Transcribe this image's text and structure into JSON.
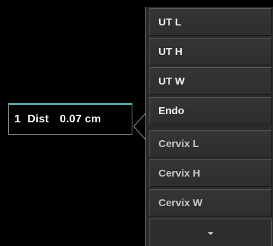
{
  "readout": {
    "index": "1",
    "label": "Dist",
    "value": "0.07 cm"
  },
  "menu": {
    "items": [
      {
        "label": "UT L"
      },
      {
        "label": "UT H"
      },
      {
        "label": "UT W"
      },
      {
        "label": "Endo"
      },
      {
        "label": "Cervix L"
      },
      {
        "label": "Cervix H"
      },
      {
        "label": "Cervix W"
      }
    ],
    "more_icon": "chevron-down-icon"
  },
  "colors": {
    "background": "#000000",
    "readout_accent": "#5aa3ad",
    "menu_bg": "#2b2b2b",
    "menu_text": "#f0f0f0"
  }
}
